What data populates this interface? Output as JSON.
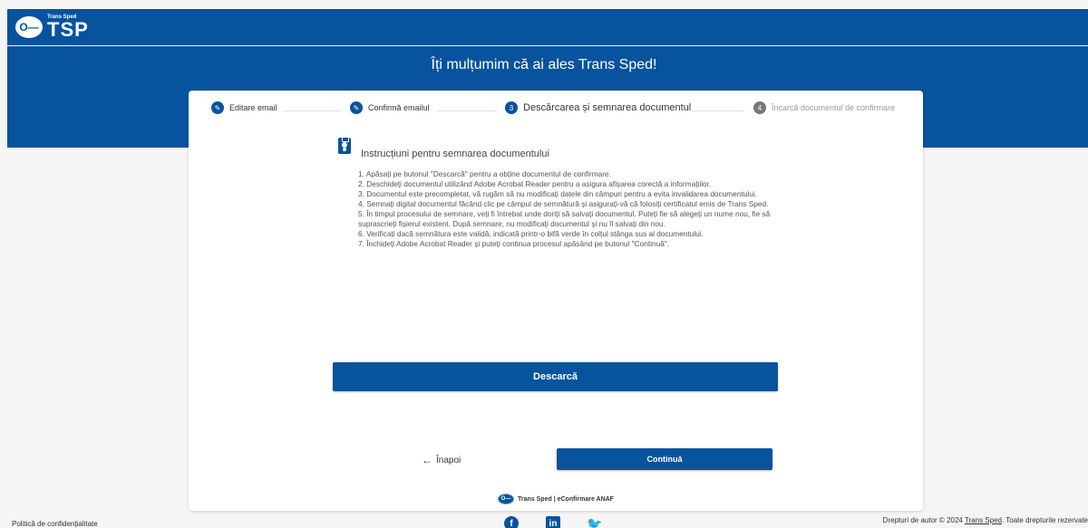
{
  "brand": {
    "small": "Trans Sped",
    "big": "TSP",
    "badge": "O—"
  },
  "hero": {
    "title": "Îți mulțumim că ai ales Trans Sped!"
  },
  "stepper": {
    "steps": [
      {
        "label": "Editare email",
        "state": "done",
        "icon": "pencil-icon"
      },
      {
        "label": "Confirmă emailul",
        "state": "done",
        "icon": "pencil-icon"
      },
      {
        "label": "Descărcarea și semnarea documentul",
        "state": "active",
        "number": "3"
      },
      {
        "label": "Încarcă documentul de confirmare",
        "state": "todo",
        "number": "4"
      }
    ]
  },
  "instructions": {
    "icon": "clipboard-user-icon",
    "title": "Instrucțiuni pentru semnarea documentului",
    "items": [
      "1. Apăsați pe butonul \"Descarcă\" pentru a obține documentul de confirmare.",
      "2. Deschideți documentul utilizând Adobe Acrobat Reader pentru a asigura afișarea corectă a informațiilor.",
      "3. Documentul este precompletat, vă rugăm să nu modificați datele din câmpuri pentru a evita invalidarea documentului.",
      "4. Semnați digital documentul făcând clic pe câmpul de semnătură și asigurați-vă că folosiți certificatul emis de Trans Sped.",
      "5. În timpul procesului de semnare, veți fi întrebat unde doriți să salvați documentul. Puteți fie să alegeți un nume nou, fie să suprascrieți fișierul existent. După semnare, nu modificați documentul și nu îl salvați din nou.",
      "6. Verificați dacă semnătura este validă, indicată printr-o bifă verde în colțul stânga sus al documentului.",
      "7. Închideți Adobe Acrobat Reader și puteți continua procesul apăsând pe butonul \"Continuă\"."
    ]
  },
  "actions": {
    "download": "Descarcă",
    "back": "Înapoi",
    "continue": "Continuă"
  },
  "card_footer": {
    "text": "Trans Sped | eConfirmare ANAF"
  },
  "footer": {
    "privacy": "Politică de confidențialitate",
    "copyright_prefix": "Drepturi de autor © 2024 ",
    "copyright_link": "Trans Sped",
    "copyright_suffix": ". Toate drepturile rezervate"
  },
  "colors": {
    "primary": "#07539d",
    "twitter": "#1d9bf0"
  }
}
